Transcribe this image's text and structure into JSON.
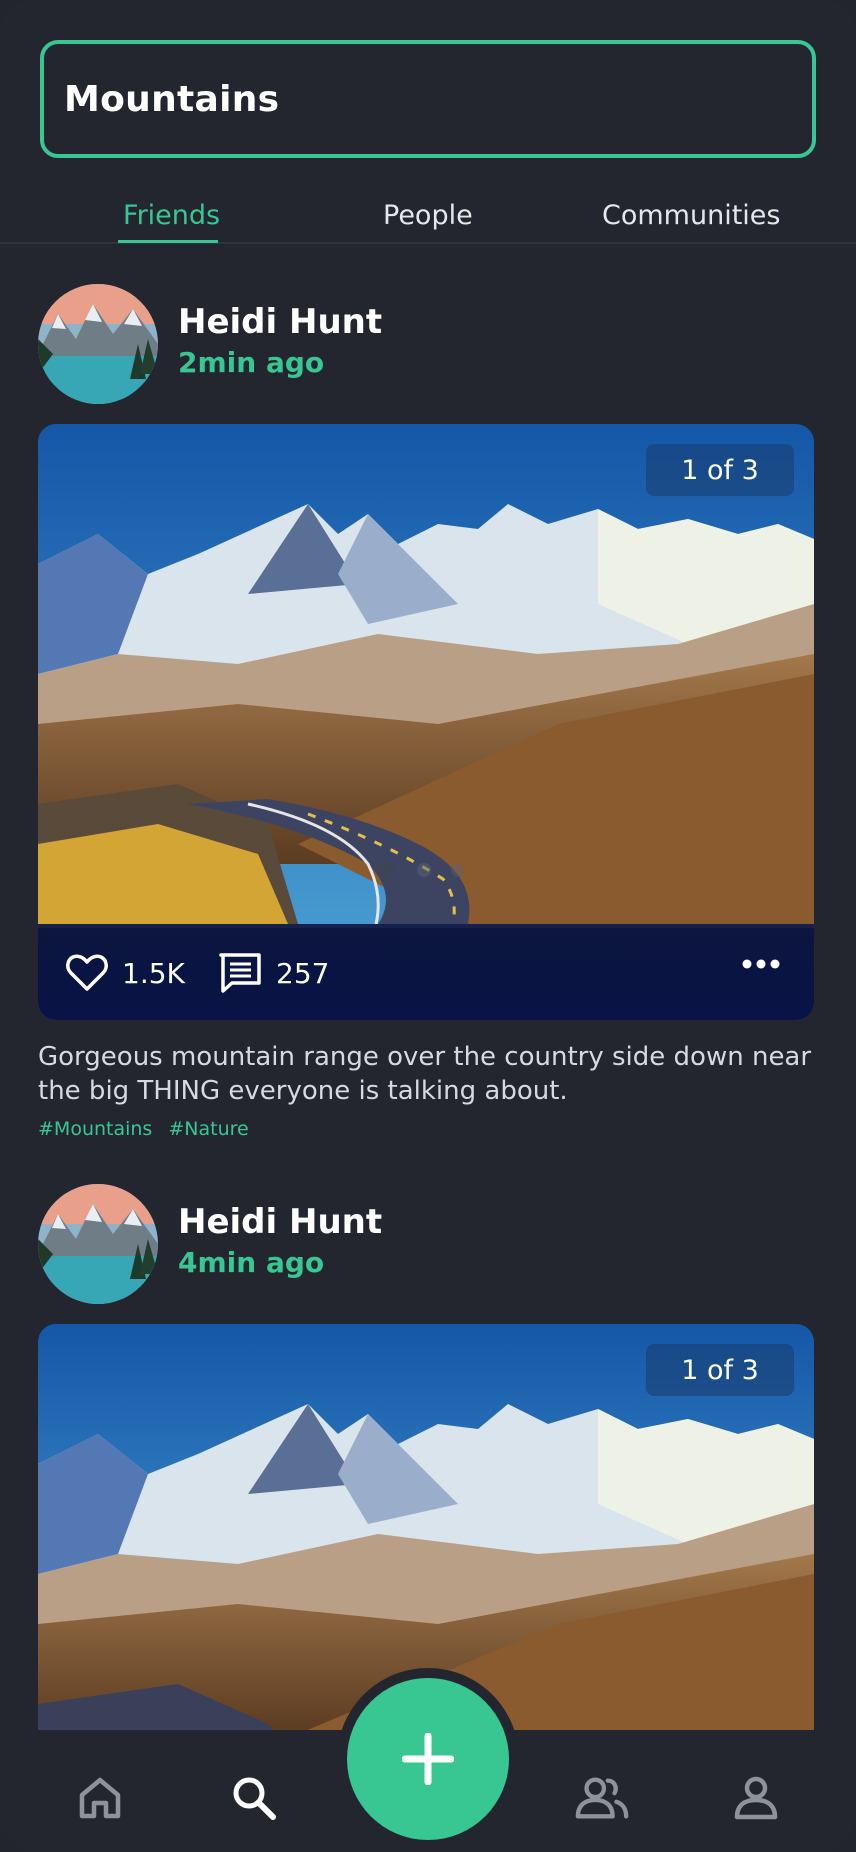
{
  "search": {
    "value": "Mountains"
  },
  "tabs": [
    {
      "label": "Friends",
      "active": true
    },
    {
      "label": "People",
      "active": false
    },
    {
      "label": "Communities",
      "active": false
    }
  ],
  "posts": [
    {
      "author": "Heidi Hunt",
      "time": "2min ago",
      "counter": "1 of 3",
      "likes": "1.5K",
      "comments": "257",
      "caption": "Gorgeous mountain range over the country side down near the big THING everyone is talking about.",
      "tags": [
        "#Mountains",
        "#Nature"
      ]
    },
    {
      "author": "Heidi Hunt",
      "time": "4min ago",
      "counter": "1 of 3"
    }
  ],
  "nav": {
    "items": [
      "home-icon",
      "search-icon",
      "add-icon",
      "people-icon",
      "profile-icon"
    ],
    "active": "search-icon"
  },
  "colors": {
    "accent": "#38c792",
    "background": "#23262f"
  }
}
